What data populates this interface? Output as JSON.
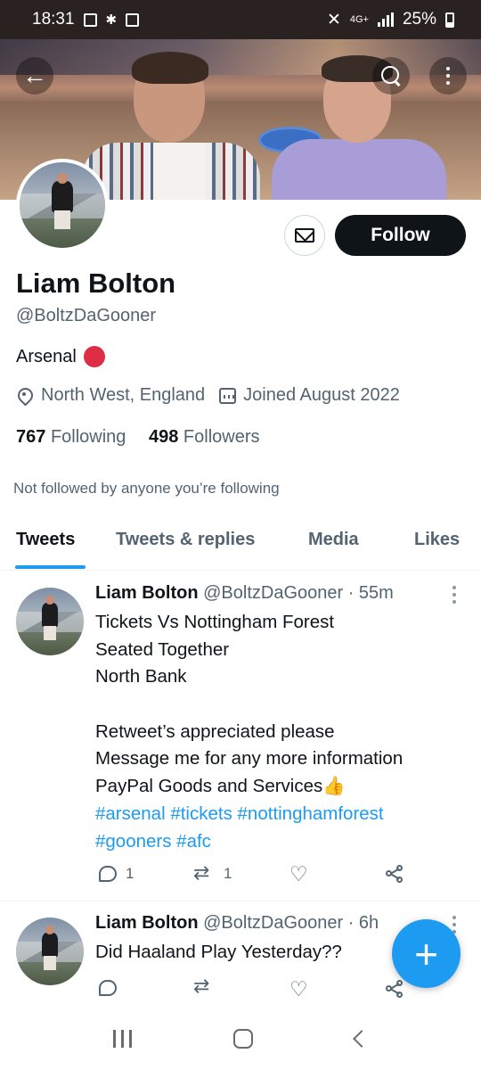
{
  "status_bar": {
    "time": "18:31",
    "network": "4G+",
    "battery": "25%"
  },
  "profile": {
    "name": "Liam Bolton",
    "handle": "@BoltzDaGooner",
    "bio": "Arsenal",
    "location": "North West, England",
    "joined": "Joined August 2022",
    "following_count": "767",
    "following_label": "Following",
    "followers_count": "498",
    "followers_label": "Followers",
    "not_followed_note": "Not followed by anyone you’re following",
    "follow_label": "Follow"
  },
  "tabs": [
    {
      "label": "Tweets",
      "active": true
    },
    {
      "label": "Tweets & replies"
    },
    {
      "label": "Media"
    },
    {
      "label": "Likes"
    }
  ],
  "tweets": [
    {
      "author": "Liam Bolton",
      "handle": "@BoltzDaGooner",
      "time": "· 55m",
      "lines": [
        "Tickets Vs Nottingham Forest",
        "Seated Together",
        "North Bank",
        "",
        "Retweet’s appreciated please",
        "Message me for any more information",
        "PayPal Goods and Services👍"
      ],
      "hashtags": [
        "#arsenal #tickets #nottinghamforest",
        "#gooners #afc"
      ],
      "replies": "1",
      "retweets": "1"
    },
    {
      "author": "Liam Bolton",
      "handle": "@BoltzDaGooner",
      "time": "· 6h",
      "lines": [
        "Did Haaland Play Yesterday??"
      ]
    }
  ],
  "colors": {
    "accent": "#1d9bf0",
    "text": "#0f1419",
    "secondary": "#536471",
    "follow_bg": "#0f1419",
    "arsenal_red": "#dd2e44"
  },
  "icons": {
    "back": "arrow-left-icon",
    "search": "search-icon",
    "more": "more-vertical-icon",
    "message": "envelope-icon",
    "location": "location-pin-icon",
    "calendar": "calendar-icon",
    "compose": "plus-icon"
  }
}
